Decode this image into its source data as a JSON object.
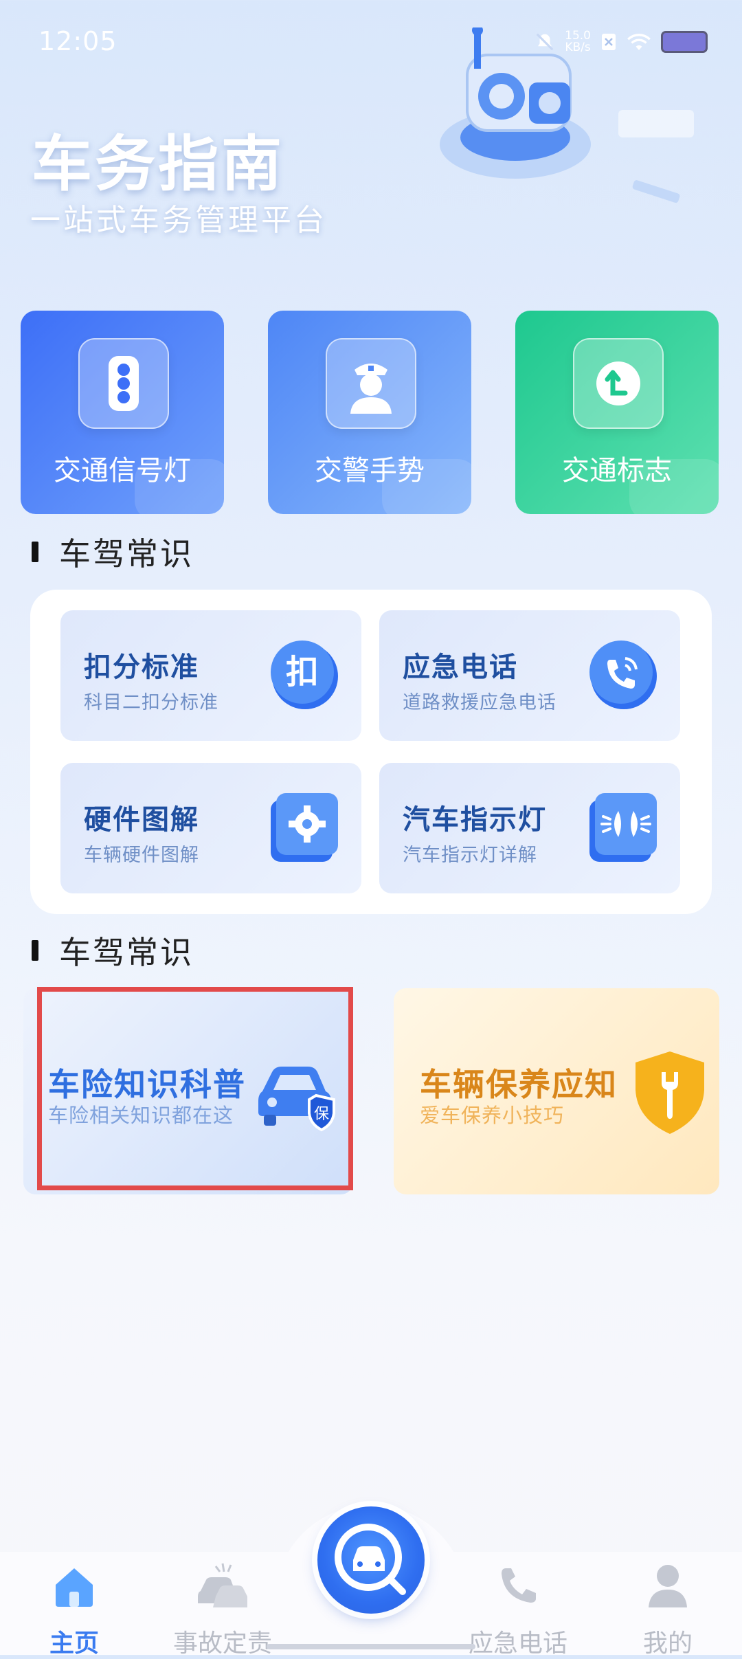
{
  "status_bar": {
    "time": "12:05",
    "net_speed_value": "15.0",
    "net_speed_unit": "KB/s"
  },
  "hero": {
    "title": "车务指南",
    "subtitle": "一站式车务管理平台"
  },
  "quick_actions": [
    {
      "label": "交通信号灯",
      "icon": "traffic-light-icon",
      "color": "#3d6ff7"
    },
    {
      "label": "交警手势",
      "icon": "traffic-police-icon",
      "color": "#4e86f6"
    },
    {
      "label": "交通标志",
      "icon": "turn-sign-icon",
      "color": "#1ec88f"
    }
  ],
  "section1": {
    "title": "车驾常识"
  },
  "knowledge": [
    {
      "title": "扣分标准",
      "subtitle": "科目二扣分标准",
      "icon_text": "扣"
    },
    {
      "title": "应急电话",
      "subtitle": "道路救援应急电话"
    },
    {
      "title": "硬件图解",
      "subtitle": "车辆硬件图解"
    },
    {
      "title": "汽车指示灯",
      "subtitle": "汽车指示灯详解"
    }
  ],
  "section2": {
    "title": "车驾常识"
  },
  "features": [
    {
      "title": "车险知识科普",
      "subtitle": "车险相关知识都在这",
      "badge": "保",
      "title_color": "#2f6fe0",
      "subtitle_color": "#7fa2dd"
    },
    {
      "title": "车辆保养应知",
      "subtitle": "爱车保养小技巧",
      "title_color": "#d9861a",
      "subtitle_color": "#f0b35a"
    }
  ],
  "nav": [
    {
      "label": "主页",
      "active": true
    },
    {
      "label": "事故定责",
      "active": false
    },
    {
      "label": "应急电话",
      "active": false
    },
    {
      "label": "我的",
      "active": false
    }
  ],
  "colors": {
    "primary": "#3a7bf0",
    "highlight_border": "#e24a4a"
  }
}
